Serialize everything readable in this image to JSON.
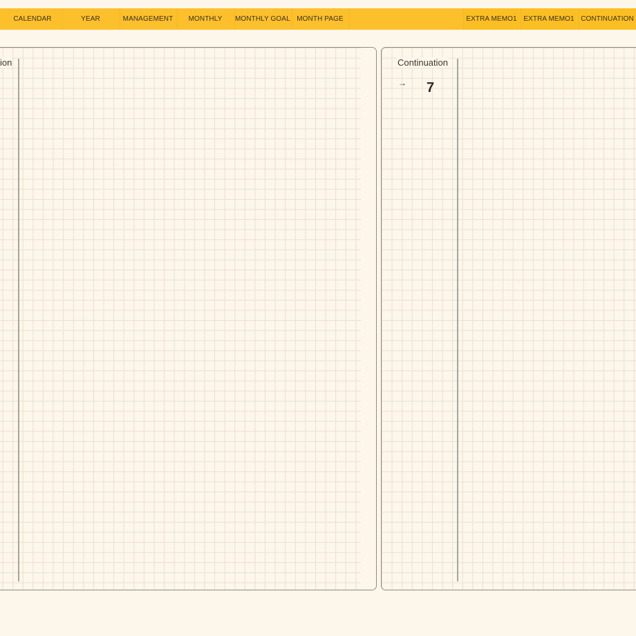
{
  "tabs": {
    "items": [
      {
        "label": "CALENDAR"
      },
      {
        "label": "YEAR"
      },
      {
        "label": "MANAGEMENT"
      },
      {
        "label": "MONTHLY"
      },
      {
        "label": "MONTHLY GOAL"
      },
      {
        "label": "MONTH PAGE"
      },
      {
        "label": ""
      },
      {
        "label": "EXTRA MEMO1"
      },
      {
        "label": "EXTRA MEMO1"
      },
      {
        "label": "CONTINUATION"
      }
    ]
  },
  "left_page": {
    "title_fragment": "ion"
  },
  "right_page": {
    "title": "Continuation",
    "arrow": "→",
    "day_number": "7"
  },
  "colors": {
    "tab_bar": "#fcc02d",
    "paper": "#fdf6ea",
    "grid": "#e7e0d2",
    "border": "#8f8a82"
  }
}
